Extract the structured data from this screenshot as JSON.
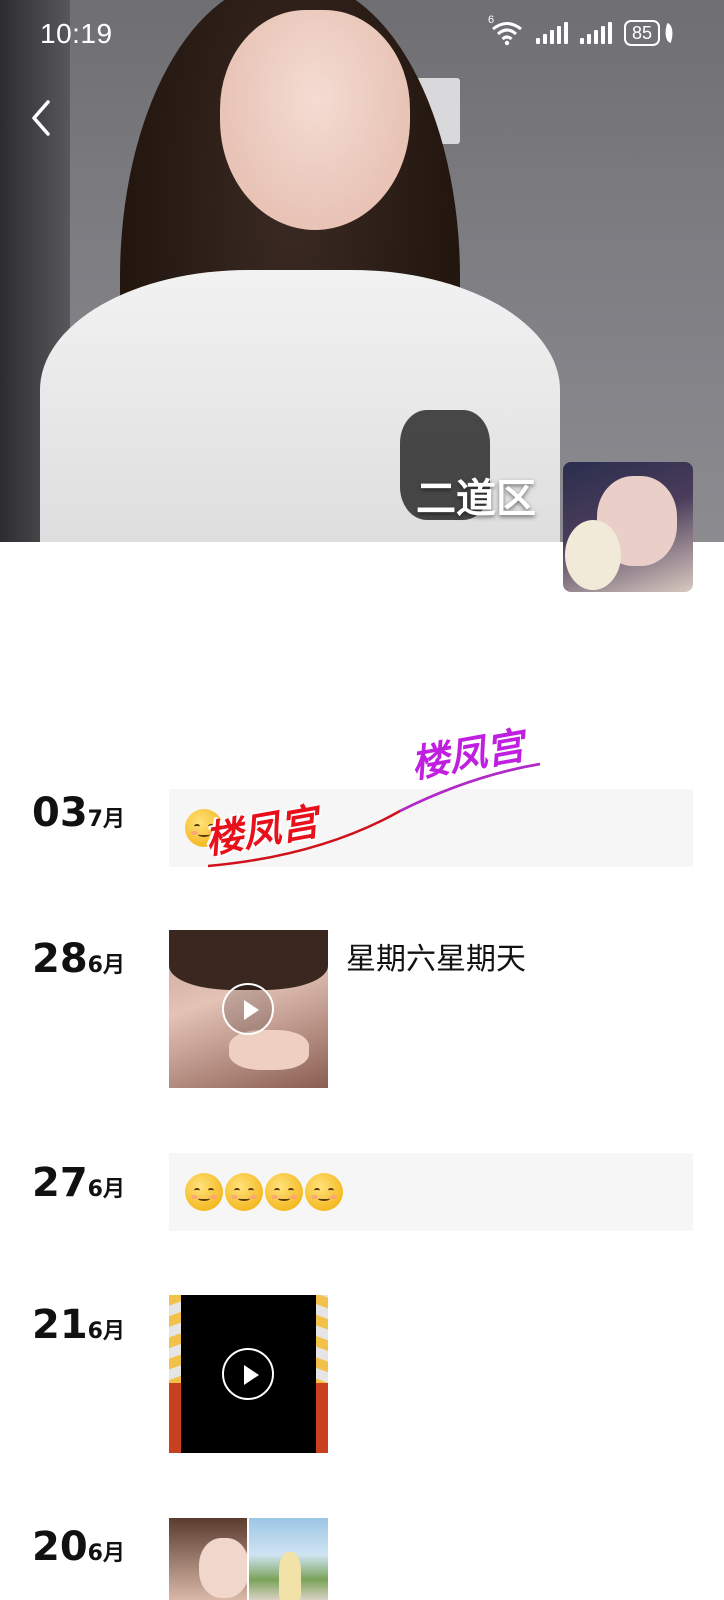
{
  "status_bar": {
    "time": "10:19",
    "wifi_badge": "6",
    "battery": "85"
  },
  "profile": {
    "name": "二道区"
  },
  "timeline": [
    {
      "day": "03",
      "month": "7月",
      "type": "text",
      "sticker_text": "楼凤宫",
      "sticker_text_2": "楼凤宫"
    },
    {
      "day": "28",
      "month": "6月",
      "type": "video",
      "caption": "星期六星期天"
    },
    {
      "day": "27",
      "month": "6月",
      "type": "emoji",
      "emoji_count": 4
    },
    {
      "day": "21",
      "month": "6月",
      "type": "video"
    },
    {
      "day": "20",
      "month": "6月",
      "type": "photos"
    }
  ],
  "icons": {
    "back": "chevron-left-icon",
    "wifi": "wifi-icon",
    "signal": "cellular-signal-icon",
    "battery": "battery-icon",
    "play": "play-icon"
  }
}
